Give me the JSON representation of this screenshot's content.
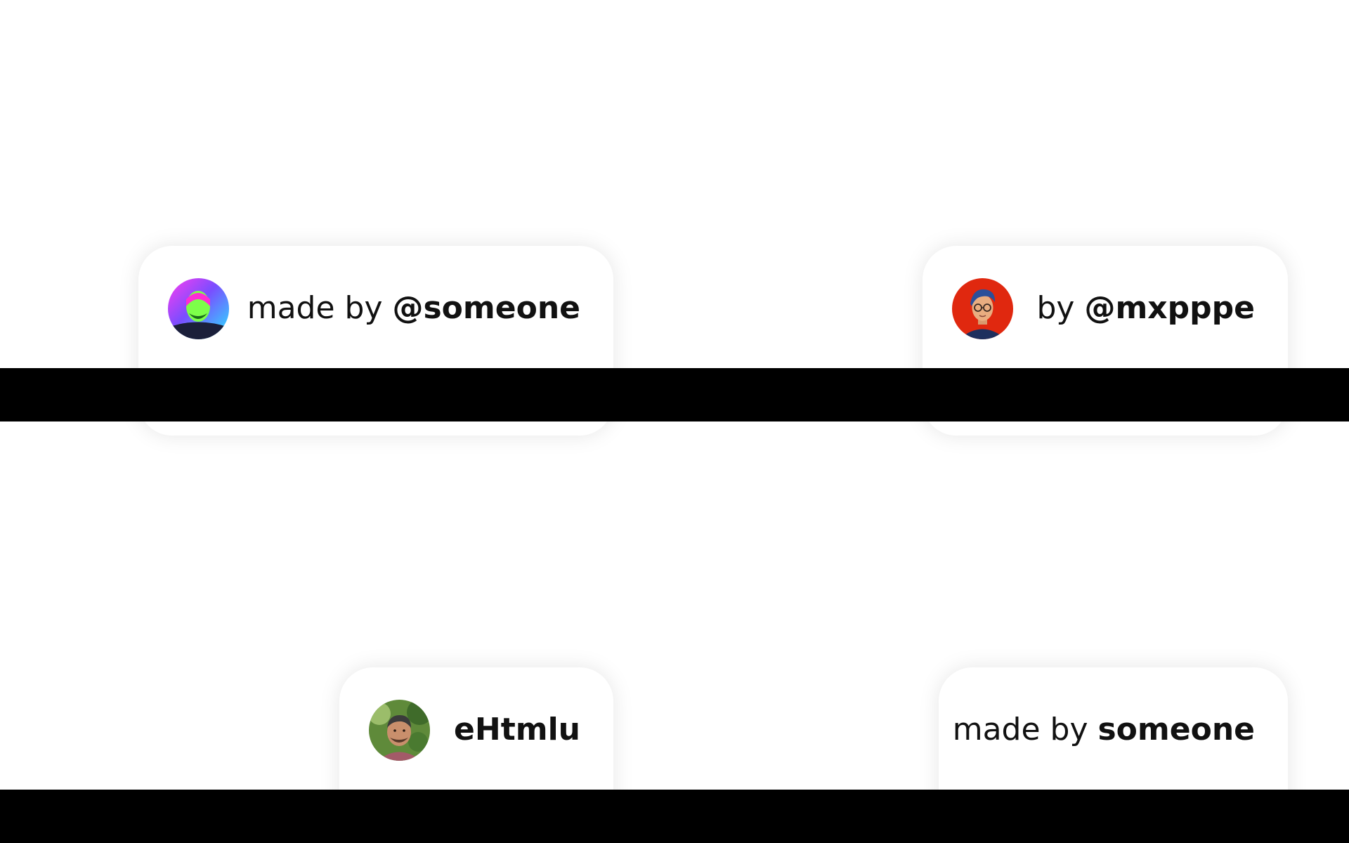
{
  "badges": [
    {
      "prefix": "made by ",
      "handle": "@someone",
      "avatar": "gradient-portrait-avatar"
    },
    {
      "prefix": "by ",
      "handle": "@mxpppe",
      "avatar": "illustrated-glasses-avatar"
    },
    {
      "prefix": "",
      "handle": "eHtmlu",
      "avatar": "photo-portrait-avatar"
    },
    {
      "prefix": "made by ",
      "handle": "someone",
      "avatar": ""
    }
  ],
  "colors": {
    "background": "#ffffff",
    "card": "#ffffff",
    "bar": "#000000",
    "text": "#111111"
  }
}
